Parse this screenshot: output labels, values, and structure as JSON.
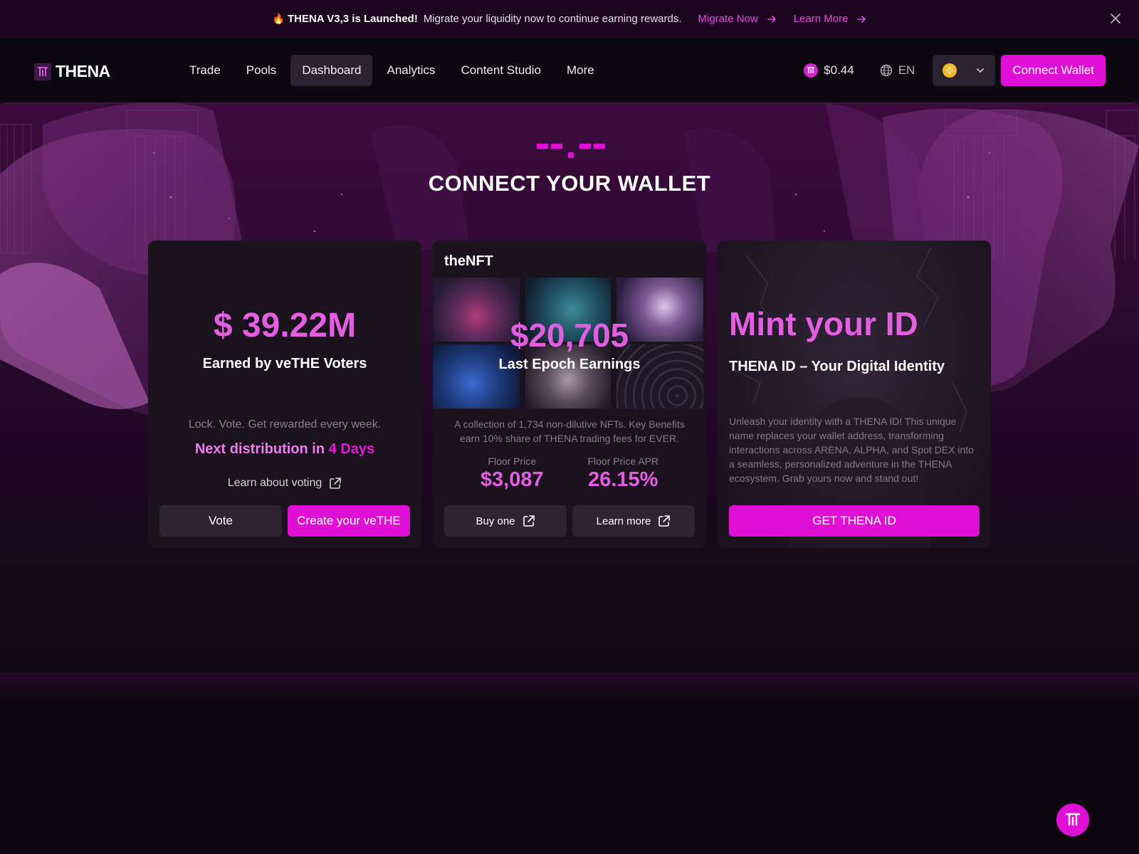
{
  "announcement": {
    "fire_icon": "fire-icon",
    "headline": "THENA V3,3 is Launched!",
    "message": "Migrate your liquidity now to continue earning rewards.",
    "migrate_link": "Migrate Now",
    "learn_link": "Learn More"
  },
  "header": {
    "brand": "THENA",
    "nav": [
      "Trade",
      "Pools",
      "Dashboard",
      "Analytics",
      "Content Studio",
      "More"
    ],
    "active_nav": "Dashboard",
    "token_price": "$0.44",
    "language": "EN",
    "connect_label": "Connect Wallet"
  },
  "page": {
    "loading": "--.--",
    "title": "CONNECT YOUR WALLET"
  },
  "voters_card": {
    "amount": "$ 39.22M",
    "caption": "Earned by veTHE Voters",
    "tagline": "Lock. Vote. Get rewarded every week.",
    "distribution_prefix": "Next distribution in",
    "distribution_days": "4 Days",
    "learn_link": "Learn about voting",
    "vote_button": "Vote",
    "create_button": "Create your veTHE"
  },
  "nft_card": {
    "heading": "theNFT",
    "earnings": "$20,705",
    "earnings_label": "Last Epoch Earnings",
    "description": "A collection of 1,734 non-dilutive NFTs. Key Benefits earn 10% share of THENA trading fees for EVER.",
    "floor_price_label": "Floor Price",
    "floor_price": "$3,087",
    "apr_label": "Floor Price APR",
    "apr": "26.15%",
    "buy_button": "Buy one",
    "learn_button": "Learn more"
  },
  "mint_card": {
    "title": "Mint your ID",
    "subtitle": "THENA ID – Your Digital Identity",
    "description": "Unleash your identity with a THENA ID! This unique name replaces your wallet address, transforming interactions across ARENA, ALPHA, and Spot DEX into a seamless, personalized adventure in the THENA ecosystem. Grab yours now and stand out!",
    "button": "GET THENA ID"
  },
  "colors": {
    "accent": "#e00fd6",
    "accent_text": "#e35ee1",
    "banner_bg": "#1d0720",
    "page_bg": "#0d0810",
    "card_bg": "#1a131e"
  }
}
